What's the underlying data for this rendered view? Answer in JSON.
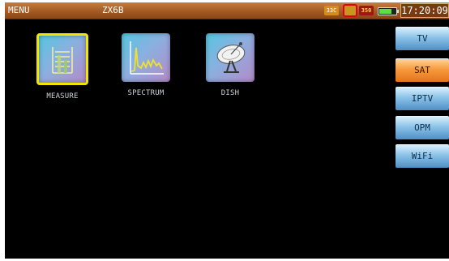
{
  "header": {
    "title": "MENU",
    "model": "ZX6B",
    "lnb_badge": "33C",
    "dc_badge": "350",
    "battery_level": 0.75,
    "clock": "17:20:09"
  },
  "apps": [
    {
      "label": "MEASURE",
      "icon": "measure-icon",
      "selected": true
    },
    {
      "label": "SPECTRUM",
      "icon": "spectrum-icon",
      "selected": false
    },
    {
      "label": "DISH",
      "icon": "dish-icon",
      "selected": false
    }
  ],
  "tabs": [
    {
      "label": "TV",
      "active": false
    },
    {
      "label": "SAT",
      "active": true
    },
    {
      "label": "IPTV",
      "active": false
    },
    {
      "label": "OPM",
      "active": false
    },
    {
      "label": "WiFi",
      "active": false
    }
  ],
  "colors": {
    "header_bg": "#a35a23",
    "selected_border": "#f0e600",
    "active_tab": "#f59a3c",
    "inactive_tab": "#8ac2e8",
    "sig_highlight": "#e0001a"
  }
}
